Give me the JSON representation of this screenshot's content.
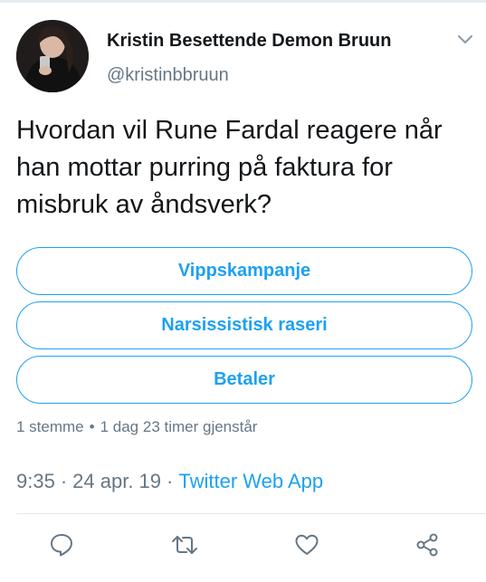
{
  "author": {
    "display_name": "Kristin Besettende Demon Bruun",
    "handle": "@kristinbbruun",
    "avatar_icon": "profile-photo"
  },
  "tweet": {
    "text": "Hvordan vil Rune Fardal reagere når han mottar purring på faktura for misbruk av åndsverk?"
  },
  "poll": {
    "options": [
      {
        "label": "Vippskampanje"
      },
      {
        "label": "Narsissistisk raseri"
      },
      {
        "label": "Betaler"
      }
    ],
    "votes": "1 stemme",
    "separator": "•",
    "time_left": "1 dag 23 timer gjenstår"
  },
  "meta": {
    "time": "9:35",
    "separator": "·",
    "date": "24 apr. 19",
    "source": "Twitter Web App"
  },
  "actions": {
    "reply_icon": "reply-icon",
    "retweet_icon": "retweet-icon",
    "like_icon": "heart-icon",
    "share_icon": "share-icon"
  },
  "colors": {
    "accent": "#1da1f2",
    "secondary_text": "#657786",
    "primary_text": "#14171a",
    "icon": "#657786"
  }
}
